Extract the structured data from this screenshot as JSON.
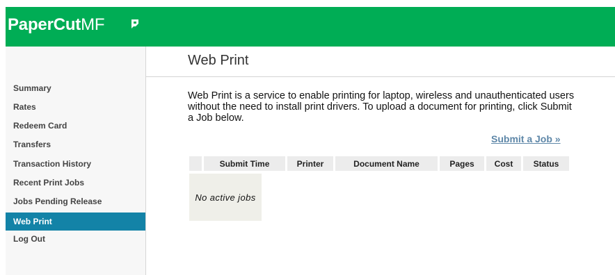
{
  "app": {
    "brand_main": "PaperCut",
    "brand_suffix": "MF"
  },
  "sidebar": {
    "items": [
      {
        "label": "Summary"
      },
      {
        "label": "Rates"
      },
      {
        "label": "Redeem Card"
      },
      {
        "label": "Transfers"
      },
      {
        "label": "Transaction History"
      },
      {
        "label": "Recent Print Jobs"
      },
      {
        "label": "Jobs Pending Release"
      },
      {
        "label": "Web Print",
        "active": true
      },
      {
        "label": "Log Out"
      }
    ]
  },
  "main": {
    "title": "Web Print",
    "intro": "Web Print is a service to enable printing for laptop, wireless and unauthenticated users without the need to install print drivers. To upload a document for printing, click Submit a Job below.",
    "submit_link": "Submit a Job »",
    "table": {
      "columns": [
        "",
        "Submit Time",
        "Printer",
        "Document Name",
        "Pages",
        "Cost",
        "Status"
      ],
      "empty_message": "No active jobs"
    }
  },
  "colors": {
    "brand_green": "#00ad55",
    "active_nav": "#1383a7",
    "link": "#5e87a8"
  }
}
